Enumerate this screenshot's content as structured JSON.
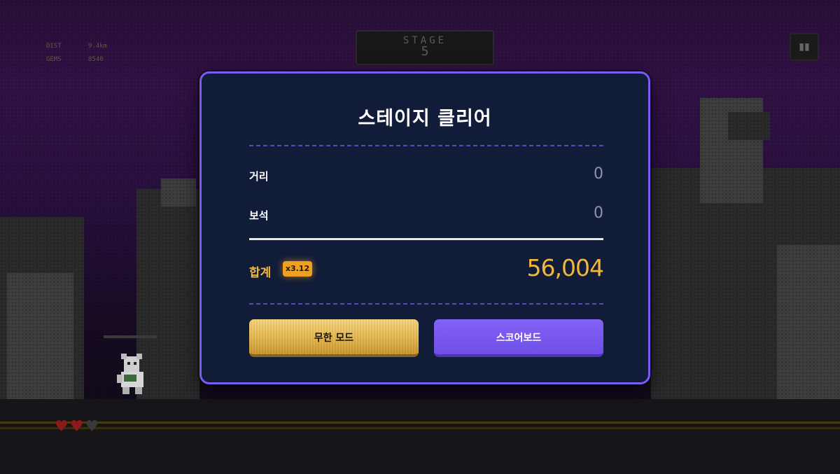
{
  "hud": {
    "dist_label": "DIST",
    "dist_value": "9.4km",
    "gems_label": "GEMS",
    "gems_value": "8540",
    "stage_label": "STAGE",
    "stage_number": "5",
    "pause_icon": "pause-icon",
    "lives_full": 2,
    "lives_total": 3
  },
  "modal": {
    "title": "스테이지 클리어",
    "rows": [
      {
        "label": "거리",
        "value": "0"
      },
      {
        "label": "보석",
        "value": "0"
      }
    ],
    "total_label": "합계",
    "multiplier": "x3.12",
    "total_value": "56,004",
    "buttons": {
      "endless_mode": "무한 모드",
      "scoreboard": "스코어보드"
    }
  },
  "colors": {
    "modal_border": "#7b5cf0",
    "modal_bg": "#111c38",
    "gold": "#f2b63a",
    "purple_button": "#6f4fe8"
  }
}
